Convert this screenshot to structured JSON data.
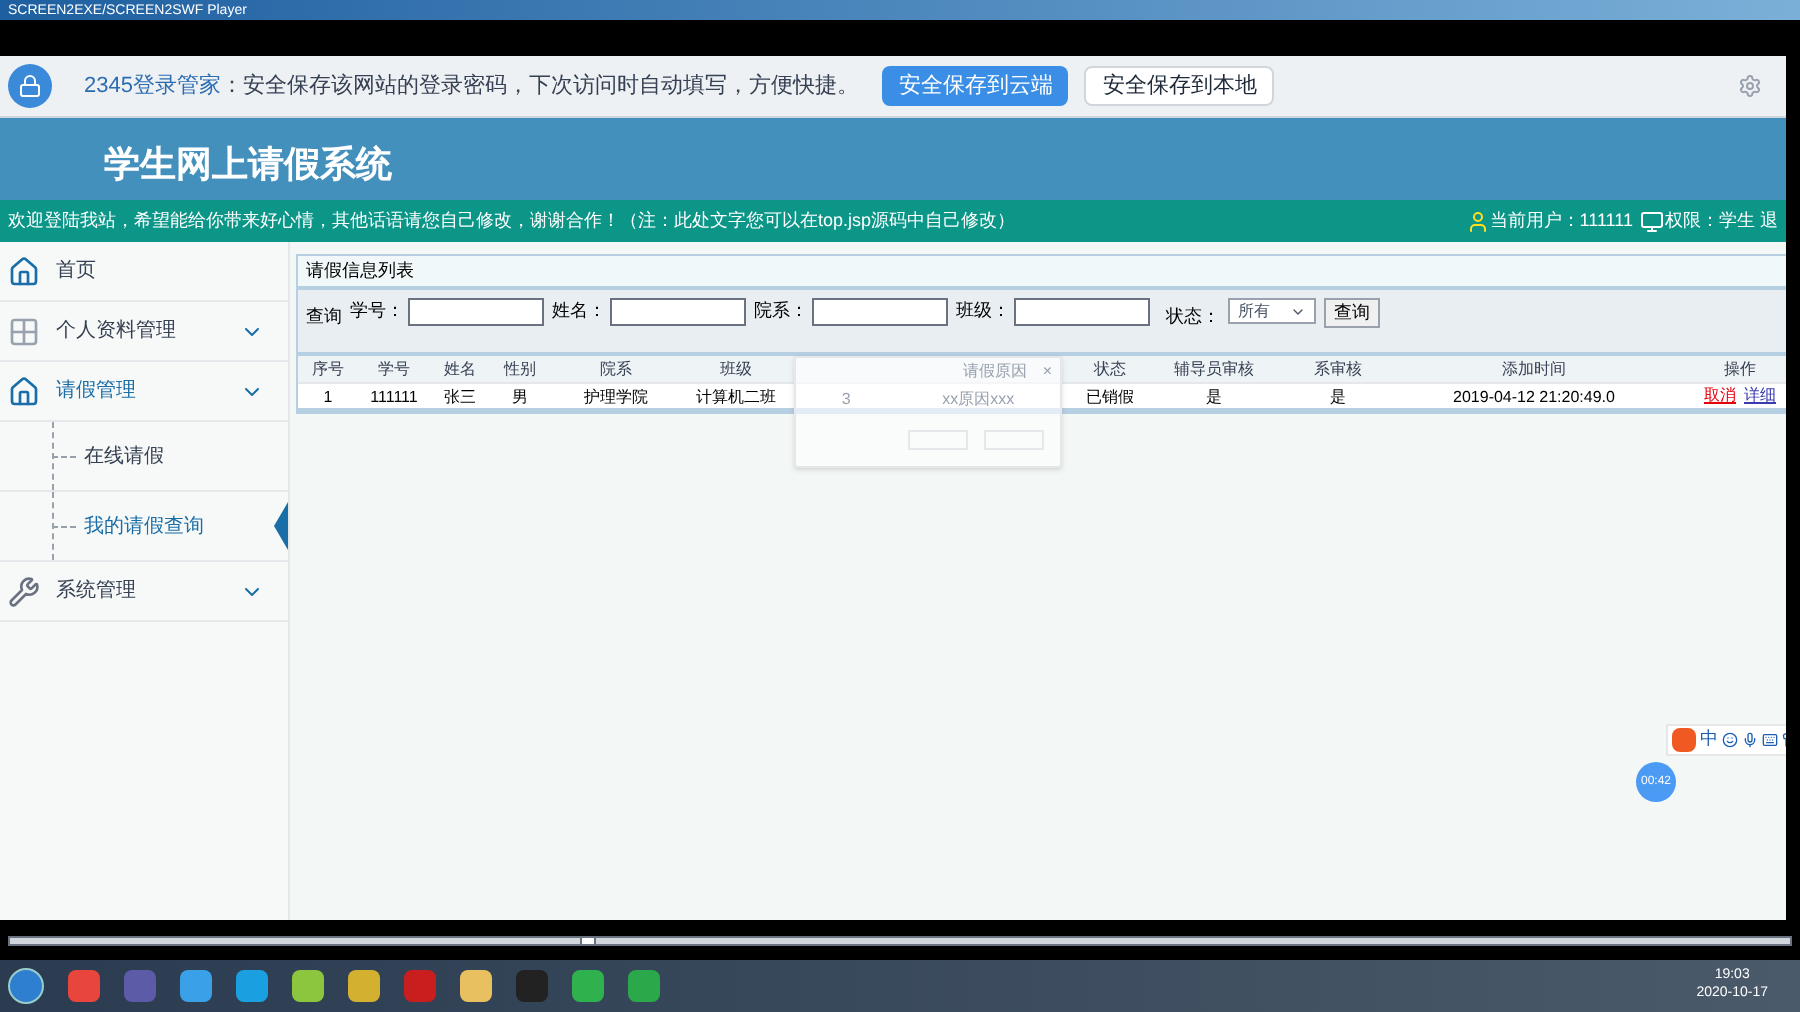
{
  "window": {
    "title": "SCREEN2EXE/SCREEN2SWF Player"
  },
  "password_bar": {
    "brand": "2345登录管家",
    "message": "：安全保存该网站的登录密码，下次访问时自动填写，方便快捷。",
    "buttons": [
      {
        "label": "安全保存到云端",
        "primary": true
      },
      {
        "label": "安全保存到本地",
        "primary": false
      }
    ]
  },
  "header": {
    "title": "学生网上请假系统"
  },
  "notice_bar": {
    "text": "欢迎登陆我站，希望能给你带来好心情，其他话语请您自己修改，谢谢合作！（注：此处文字您可以在top.jsp源码中自己修改）",
    "user": "当前用户：111111",
    "role": "权限：学生 退"
  },
  "sidebar": {
    "items": [
      {
        "label": "首页",
        "kind": "link",
        "selected": false
      },
      {
        "label": "个人资料管理",
        "kind": "menu",
        "selected": false
      },
      {
        "label": "请假管理",
        "kind": "menu",
        "selected": true,
        "children": [
          {
            "label": "在线请假",
            "selected": false
          },
          {
            "label": "我的请假查询",
            "selected": true
          }
        ]
      },
      {
        "label": "系统管理",
        "kind": "menu",
        "selected": false
      }
    ]
  },
  "panel": {
    "title": "请假信息列表",
    "search": {
      "prefix": "查询",
      "fields": [
        {
          "label": "学号："
        },
        {
          "label": "姓名："
        },
        {
          "label": "院系："
        },
        {
          "label": "班级："
        }
      ],
      "status_label": "状态：",
      "status_value": "所有",
      "button": "查询"
    },
    "table": {
      "columns": [
        "序号",
        "学号",
        "姓名",
        "性别",
        "院系",
        "班级",
        "状态",
        "辅导员审核",
        "系审核",
        "添加时间",
        "操作"
      ],
      "rows": [
        {
          "cells": [
            "1",
            "111111",
            "张三",
            "男",
            "护理学院",
            "计算机二班",
            "已销假",
            "是",
            "是",
            "2019-04-12 21:20:49.0"
          ],
          "actions": [
            "取消",
            "详细"
          ]
        }
      ]
    },
    "faded_dialog": {
      "header": "请假原因",
      "close": "×",
      "values": [
        "3",
        "xx原因xxx"
      ]
    }
  },
  "player": {
    "timer": "00:42",
    "ime": "中",
    "level": 0.32
  },
  "taskbar": {
    "time": "19:03",
    "date": "2020-10-17"
  }
}
